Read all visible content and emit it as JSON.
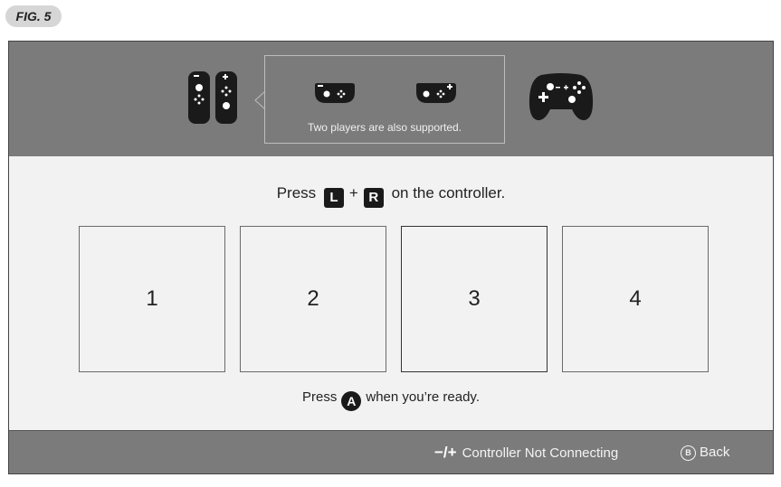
{
  "figure_label": "FIG. 5",
  "header": {
    "bubble_text": "Two players are also supported.",
    "icons": [
      "joycon-pair-icon",
      "joycon-sideways-icon",
      "joycon-sideways-icon",
      "pro-controller-icon"
    ]
  },
  "instruction": {
    "prefix": "Press",
    "key_l": "L",
    "plus": "+",
    "key_r": "R",
    "suffix": "on the controller."
  },
  "slots": [
    {
      "label": "1",
      "selected": false
    },
    {
      "label": "2",
      "selected": false
    },
    {
      "label": "3",
      "selected": true
    },
    {
      "label": "4",
      "selected": false
    }
  ],
  "ready": {
    "prefix": "Press",
    "button": "A",
    "suffix": "when you’re ready."
  },
  "footer": {
    "minus_plus": "−/+",
    "not_connecting_label": "Controller Not Connecting",
    "b_button": "B",
    "back_label": "Back"
  },
  "colors": {
    "header_bg": "#7b7b7b",
    "panel_bg": "#f2f2f2",
    "icon_dark": "#1a1a1a"
  }
}
